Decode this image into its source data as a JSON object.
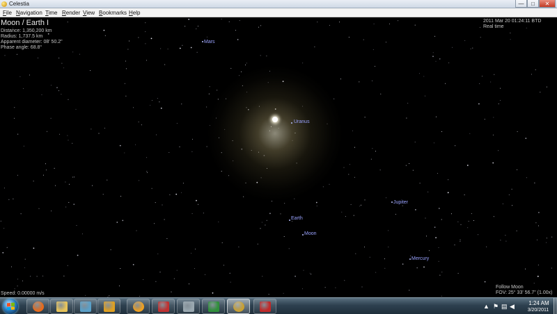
{
  "window": {
    "title": "Celestia",
    "min_glyph": "—",
    "max_glyph": "□",
    "close_glyph": "✕"
  },
  "menu": [
    "File",
    "Navigation",
    "Time",
    "Render",
    "View",
    "Bookmarks",
    "Help"
  ],
  "hud": {
    "target": "Moon / Earth I",
    "info": [
      "Distance: 1,350,200 km",
      "Radius: 1,737.5 km",
      "Apparent diameter: 08' 50.2\"",
      "Phase angle: 68.8°"
    ],
    "time": "2011 Mar 20 01:24:11 BTD",
    "time_mode": "Real time",
    "speed": "Speed: 0.00000 m/s",
    "follow": "Follow Moon",
    "fov": "FOV: 25° 33' 56.7\" (1.00x)"
  },
  "labels": {
    "mars": "Mars",
    "uranus": "Uranus",
    "jupiter": "Jupiter",
    "earth": "Earth",
    "moon": "Moon",
    "mercury": "Mercury"
  },
  "taskbar": {
    "apps": [
      {
        "name": "firefox",
        "icon": "firefox-icon",
        "color": "#e86a1a"
      },
      {
        "name": "explorer",
        "icon": "folder-icon",
        "color": "#e8c45a"
      },
      {
        "name": "app-g",
        "icon": "app-icon",
        "color": "#5aa0c8"
      },
      {
        "name": "media",
        "icon": "media-player-icon",
        "color": "#e0a020"
      },
      {
        "name": "orange-ball",
        "icon": "orange-app-icon",
        "color": "#f0a020"
      },
      {
        "name": "pdf",
        "icon": "pdf-icon",
        "color": "#c03030"
      },
      {
        "name": "control-panel",
        "icon": "control-panel-icon",
        "color": "#9aa8b0"
      },
      {
        "name": "excel",
        "icon": "excel-icon",
        "color": "#2f8f3a"
      },
      {
        "name": "celestia",
        "icon": "celestia-icon",
        "color": "#caa030"
      },
      {
        "name": "acrobat",
        "icon": "acrobat-icon",
        "color": "#c02828"
      }
    ],
    "tray_up": "▲",
    "clock_time": "1:24 AM",
    "clock_date": "3/20/2011"
  },
  "colors": {
    "label_blue": "#9aa3ff",
    "hud_gray": "#c8c8c8"
  }
}
